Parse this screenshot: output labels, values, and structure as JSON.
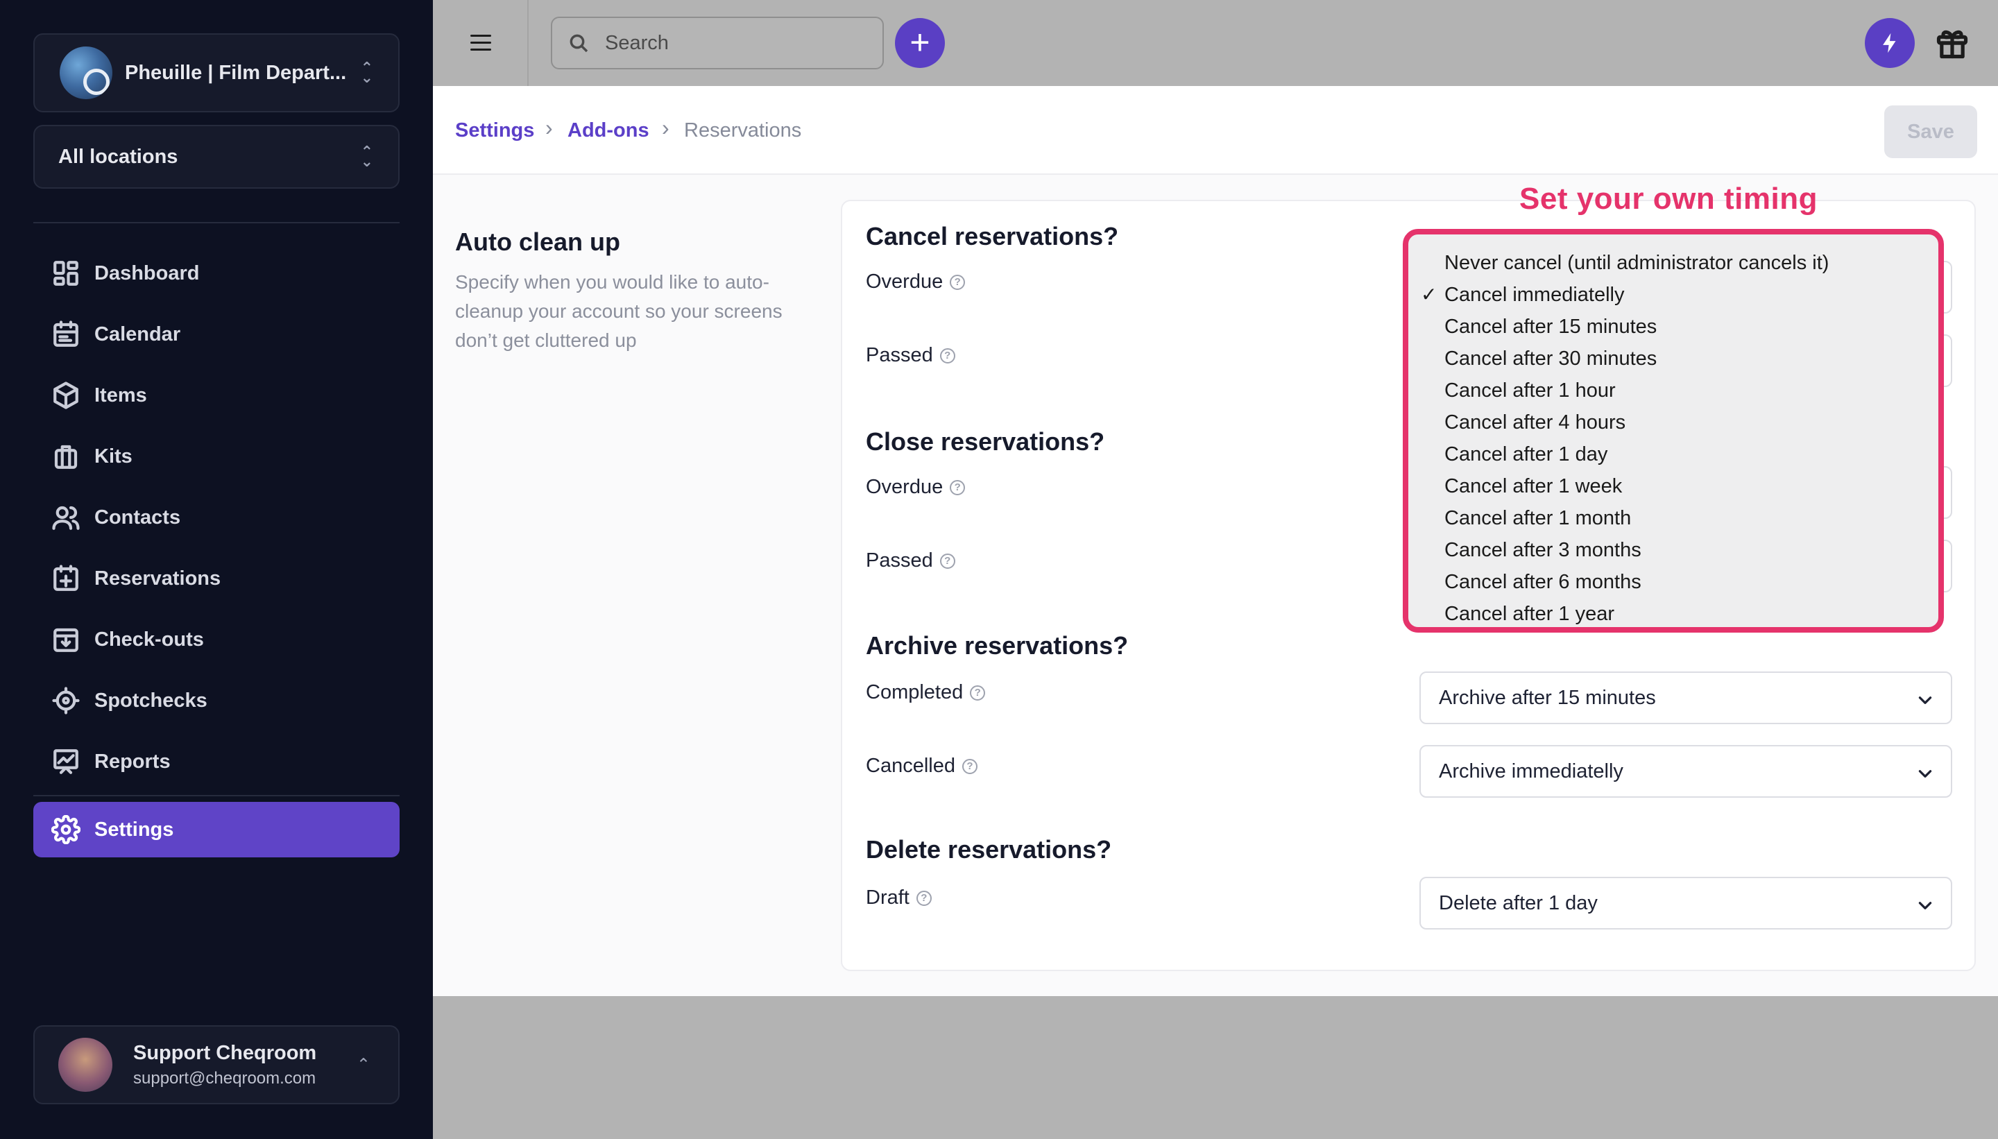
{
  "sidebar": {
    "org": "Pheuille | Film Depart...",
    "location": "All locations",
    "nav": [
      {
        "label": "Dashboard",
        "icon": "dashboard-icon"
      },
      {
        "label": "Calendar",
        "icon": "calendar-icon"
      },
      {
        "label": "Items",
        "icon": "box-icon"
      },
      {
        "label": "Kits",
        "icon": "briefcase-icon"
      },
      {
        "label": "Contacts",
        "icon": "users-icon"
      },
      {
        "label": "Reservations",
        "icon": "calendar-plus-icon"
      },
      {
        "label": "Check-outs",
        "icon": "inbox-download-icon"
      },
      {
        "label": "Spotchecks",
        "icon": "crosshair-icon"
      },
      {
        "label": "Reports",
        "icon": "chart-board-icon"
      },
      {
        "label": "Settings",
        "icon": "gear-icon",
        "active": true
      }
    ],
    "user": {
      "name": "Support Cheqroom",
      "email": "support@cheqroom.com"
    }
  },
  "topbar": {
    "search_placeholder": "Search",
    "add_label": "+"
  },
  "breadcrumb": {
    "items": [
      "Settings",
      "Add-ons",
      "Reservations"
    ],
    "save_label": "Save"
  },
  "section": {
    "title": "Auto clean up",
    "description": "Specify when you would like to auto-cleanup your account so your screens don’t get cluttered up"
  },
  "groups": {
    "cancel": {
      "title": "Cancel reservations?",
      "overdue_label": "Overdue",
      "passed_label": "Passed"
    },
    "close": {
      "title": "Close reservations?",
      "overdue_label": "Overdue",
      "passed_label": "Passed"
    },
    "archive": {
      "title": "Archive reservations?",
      "completed_label": "Completed",
      "completed_value": "Archive after 15 minutes",
      "cancelled_label": "Cancelled",
      "cancelled_value": "Archive immediatelly"
    },
    "delete": {
      "title": "Delete reservations?",
      "draft_label": "Draft",
      "draft_value": "Delete after 1 day"
    }
  },
  "annotation": "Set your own timing",
  "dropdown": {
    "selected_index": 1,
    "check_glyph": "✓",
    "options": [
      "Never cancel (until administrator cancels it)",
      "Cancel immediatelly",
      "Cancel after 15 minutes",
      "Cancel after 30 minutes",
      "Cancel after 1 hour",
      "Cancel after 4 hours",
      "Cancel after 1 day",
      "Cancel after 1 week",
      "Cancel after 1 month",
      "Cancel after 3 months",
      "Cancel after 6 months",
      "Cancel after 1 year"
    ]
  },
  "colors": {
    "accent": "#5b3fc8",
    "annotation": "#e5336b",
    "sidebar_bg": "#0d1122"
  }
}
